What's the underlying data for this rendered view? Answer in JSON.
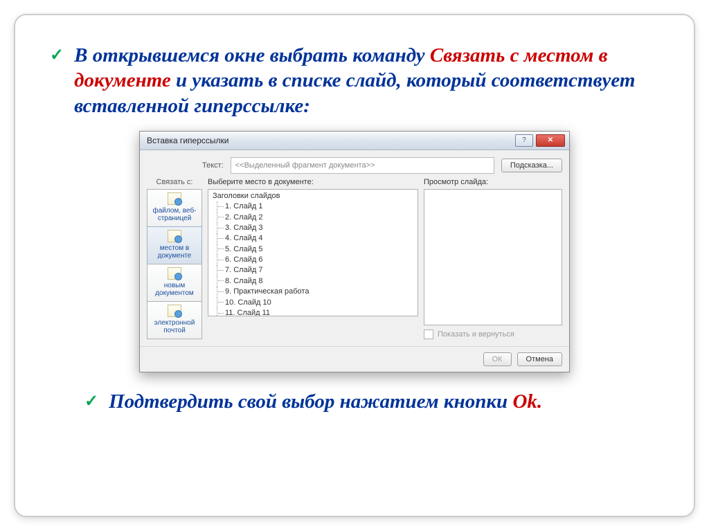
{
  "bullet1": {
    "part1": "В открывшемся окне выбрать команду ",
    "red": "Связать с местом в документе ",
    "part2": "и указать в списке слайд, который соответствует вставленной гиперссылке:"
  },
  "bullet2": {
    "text": "Подтвердить свой выбор нажатием кнопки ",
    "red": "Ok."
  },
  "dialog": {
    "title": "Вставка гиперссылки",
    "link_with_label": "Связать с:",
    "text_label": "Текст:",
    "text_placeholder": "<<Выделенный фрагмент документа>>",
    "hint_button": "Подсказка...",
    "sidebar": [
      {
        "label": "файлом, веб-страницей"
      },
      {
        "label": "местом в документе"
      },
      {
        "label": "новым документом"
      },
      {
        "label": "электронной почтой"
      }
    ],
    "selected_sidebar_index": 1,
    "choose_place_label": "Выберите место в документе:",
    "tree_root": "Заголовки слайдов",
    "tree_items": [
      "1. Слайд 1",
      "2. Слайд 2",
      "3. Слайд 3",
      "4. Слайд 4",
      "5. Слайд 5",
      "6. Слайд 6",
      "7. Слайд 7",
      "8. Слайд 8",
      "9. Практическая работа",
      "10. Слайд 10",
      "11. Слайд 11"
    ],
    "preview_label": "Просмотр слайда:",
    "show_return": "Показать и вернуться",
    "ok": "ОК",
    "cancel": "Отмена"
  }
}
